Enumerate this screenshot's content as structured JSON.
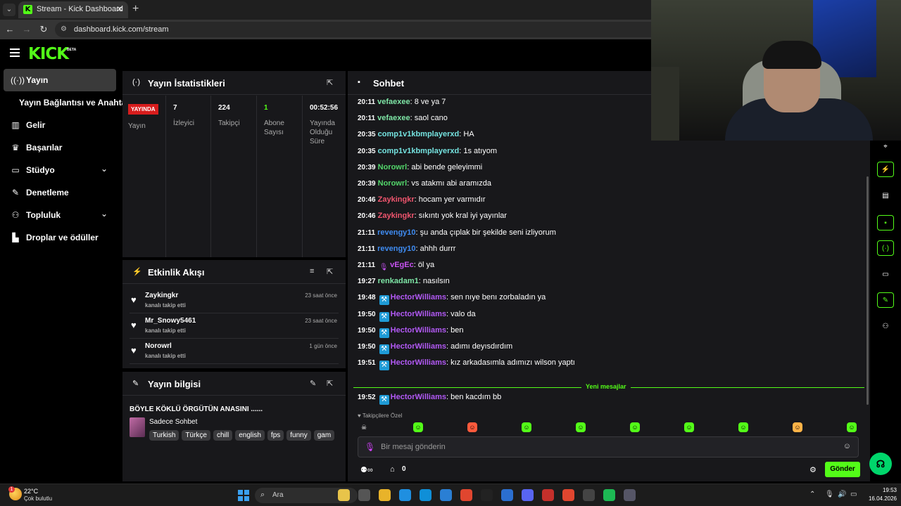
{
  "browser": {
    "tab_title": "Stream - Kick Dashboard",
    "url": "dashboard.kick.com/stream"
  },
  "app": {
    "logo": "KICK",
    "beta": "BETA"
  },
  "sidebar": {
    "items": [
      {
        "label": "Yayın",
        "icon": "broadcast-icon"
      },
      {
        "label": "Yayın Bağlantısı ve Anahtarı"
      },
      {
        "label": "Gelir",
        "icon": "chart-icon"
      },
      {
        "label": "Başarılar",
        "icon": "trophy-icon"
      },
      {
        "label": "Stüdyo",
        "icon": "studio-icon"
      },
      {
        "label": "Denetleme",
        "icon": "wrench-icon"
      },
      {
        "label": "Topluluk",
        "icon": "community-icon"
      },
      {
        "label": "Droplar ve ödüller",
        "icon": "gift-icon"
      }
    ]
  },
  "stats": {
    "title": "Yayın İstatistikleri",
    "live_badge": "YAYINDA",
    "live_label": "Yayın",
    "viewers": {
      "value": "7",
      "label": "İzleyici"
    },
    "followers": {
      "value": "224",
      "label": "Takipçi"
    },
    "subscribers": {
      "value": "1",
      "label": "Abone Sayısı"
    },
    "uptime": {
      "value": "00:52:56",
      "label": "Yayında Olduğu Süre"
    }
  },
  "activity": {
    "title": "Etkinlik Akışı",
    "events": [
      {
        "name": "Zaykingkr",
        "action": "kanalı takip etti",
        "time": "23 saat önce"
      },
      {
        "name": "Mr_Snowy5461",
        "action": "kanalı takip etti",
        "time": "23 saat önce"
      },
      {
        "name": "Norowrl",
        "action": "kanalı takip etti",
        "time": "1 gün önce"
      }
    ]
  },
  "stream_info": {
    "title": "Yayın bilgisi",
    "stream_title": "BÖYLE KÖKLÜ ÖRGÜTÜN ANASINI ......",
    "category": "Sadece Sohbet",
    "tags": [
      "Turkish",
      "Türkçe",
      "chill",
      "english",
      "fps",
      "funny",
      "gam"
    ]
  },
  "chat": {
    "title": "Sohbet",
    "messages": [
      {
        "time": "20:11",
        "user": "vefaexee",
        "color": "#7ee6a6",
        "text": "8 ve ya 7"
      },
      {
        "time": "20:11",
        "user": "vefaexee",
        "color": "#7ee6a6",
        "text": "saol cano"
      },
      {
        "time": "20:35",
        "user": "comp1v1kbmplayerxd",
        "color": "#75e3e0",
        "text": "HA"
      },
      {
        "time": "20:35",
        "user": "comp1v1kbmplayerxd",
        "color": "#75e3e0",
        "text": "1s atıyom"
      },
      {
        "time": "20:39",
        "user": "Norowrl",
        "color": "#53d66b",
        "text": "abi bende geleyimmi"
      },
      {
        "time": "20:39",
        "user": "Norowrl",
        "color": "#53d66b",
        "text": "vs atakmı abi aramızda"
      },
      {
        "time": "20:46",
        "user": "Zaykingkr",
        "color": "#f0556e",
        "text": "hocam yer varmıdır"
      },
      {
        "time": "20:46",
        "user": "Zaykingkr",
        "color": "#f0556e",
        "text": "sıkıntı yok kral iyi yayınlar"
      },
      {
        "time": "21:11",
        "user": "revengy10",
        "color": "#3f8cf2",
        "text": "şu anda çıplak bir şekilde seni izliyorum"
      },
      {
        "time": "21:11",
        "user": "revengy10",
        "color": "#3f8cf2",
        "text": "ahhh durrr"
      },
      {
        "time": "21:11",
        "user": "vEgEc",
        "color": "#c752f2",
        "text": "öl ya",
        "badge": "mic"
      },
      {
        "time": "19:27",
        "user": "renkadam1",
        "color": "#7ee6a6",
        "text": "nasılsın"
      },
      {
        "time": "19:48",
        "user": "HectorWilliams",
        "color": "#b259f5",
        "text": "sen nıye benı zorbaladın ya",
        "badge": "hammer"
      },
      {
        "time": "19:50",
        "user": "HectorWilliams",
        "color": "#b259f5",
        "text": "valo da",
        "badge": "hammer"
      },
      {
        "time": "19:50",
        "user": "HectorWilliams",
        "color": "#b259f5",
        "text": "ben",
        "badge": "hammer"
      },
      {
        "time": "19:50",
        "user": "HectorWilliams",
        "color": "#b259f5",
        "text": "adımı deyısdırdım",
        "badge": "hammer"
      },
      {
        "time": "19:51",
        "user": "HectorWilliams",
        "color": "#b259f5",
        "text": "kız arkadasımla adımızı wilson yaptı",
        "badge": "hammer"
      }
    ],
    "new_messages_label": "Yeni mesajlar",
    "new_message": {
      "time": "19:52",
      "user": "HectorWilliams",
      "color": "#b259f5",
      "text": "ben kacdım bb",
      "badge": "hammer"
    },
    "follower_note": "Takipçilere Özel",
    "input_placeholder": "Bir mesaj gönderin",
    "points": "0",
    "send_label": "Gönder"
  },
  "taskbar": {
    "temp": "22°C",
    "condition": "Çok bulutlu",
    "weather_badge": "1",
    "search_label": "Ara",
    "time": "19:53",
    "date": "16.04.2026"
  },
  "colors": {
    "accent": "#53fc18",
    "panel": "#18181b",
    "live": "#d81d1d"
  }
}
